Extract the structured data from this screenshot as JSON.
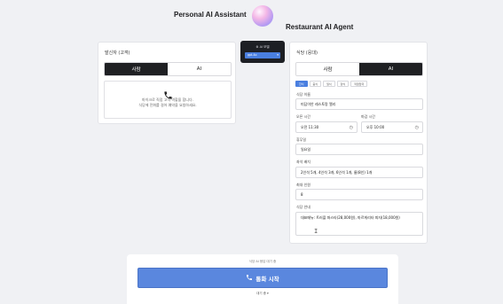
{
  "header": {
    "left_title": "Personal AI Assistant",
    "right_title": "Restaurant AI Agent"
  },
  "caller": {
    "title": "발신자 (고객)",
    "tabs": [
      "사람",
      "AI"
    ],
    "active_tab": 0,
    "info_line1": "마이크로 직접 고객 역할을 합니다.",
    "info_line2": "식당에 전화를 걸어 예약을 요청하세요."
  },
  "control": {
    "label": "AI 모델",
    "selected": "gpt-4o",
    "icon": "gear-icon"
  },
  "restaurant": {
    "title": "식당 (응대)",
    "tabs": [
      "사람",
      "AI"
    ],
    "active_tab": 1,
    "chips": [
      "한식",
      "중식",
      "일식",
      "양식",
      "직접입력"
    ],
    "active_chip": 0,
    "name_label": "식당 이름",
    "name_value": "미담이안 레스토랑 엘리",
    "open_label": "오픈 시간",
    "open_value": "오전 11:30",
    "close_label": "마감 시간",
    "close_value": "오후 10:00",
    "closed_label": "휴무일",
    "closed_value": "일요일",
    "tables_label": "좌석 배치",
    "tables_value": "2인석 5개, 4인석 3개, 6인석 1개, 룸(8인) 1개",
    "max_label": "최대 인원",
    "max_value": "8",
    "guide_label": "식당 안내",
    "guide_value": "대표메뉴: 트러플 파스타(28,000원), 마르게리타 피자(18,000원)"
  },
  "bottom": {
    "hint": "식당 AI 응답 대기 중",
    "call_label": "통화 시작",
    "toggle_label": "대기 중 ▾"
  },
  "colors": {
    "accent": "#5a87de",
    "dark": "#1f2023"
  }
}
